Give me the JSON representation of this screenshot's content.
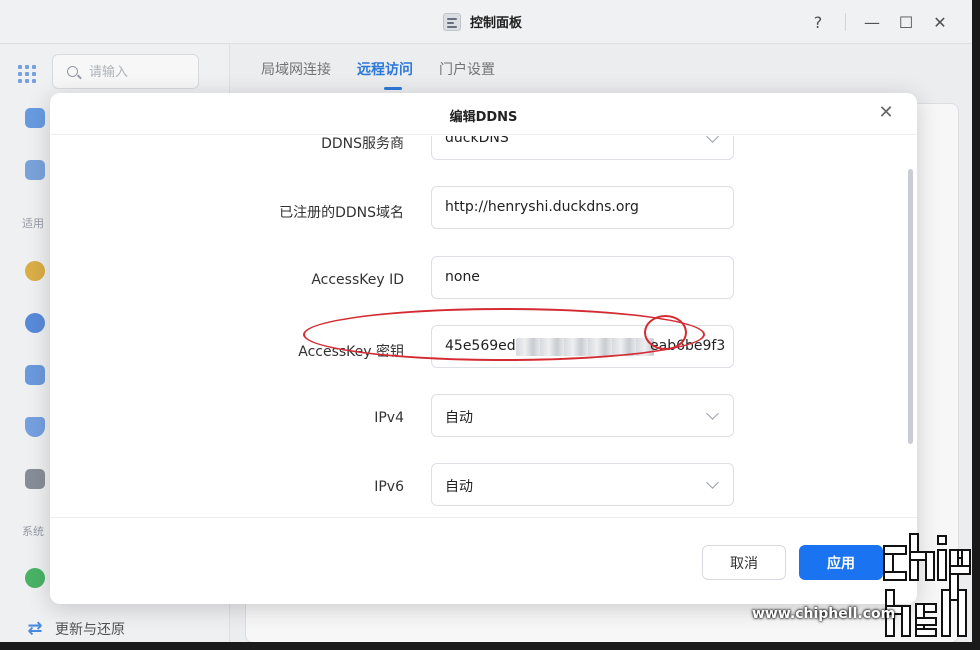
{
  "window": {
    "title": "控制面板",
    "help_label": "?",
    "minimize_label": "—",
    "maximize_label": "☐",
    "close_label": "✕"
  },
  "sidebar": {
    "search_placeholder": "请输入",
    "section_general": "适用",
    "section_system": "系统",
    "bottom_item": "更新与还原",
    "icons": [
      "user-icon",
      "file-icon",
      "storage-icon",
      "network-icon",
      "router-icon",
      "shield-icon",
      "hardware-icon",
      "info-icon",
      "sync-icon"
    ]
  },
  "tabs": [
    {
      "label": "局域网连接",
      "active": false
    },
    {
      "label": "远程访问",
      "active": true
    },
    {
      "label": "门户设置",
      "active": false
    }
  ],
  "modal": {
    "title": "编辑DDNS",
    "close_label": "✕",
    "fields": {
      "provider": {
        "label": "DDNS服务商",
        "value": "duckDNS"
      },
      "domain": {
        "label": "已注册的DDNS域名",
        "value": "http://henryshi.duckdns.org"
      },
      "access_key_id": {
        "label": "AccessKey ID",
        "value": "none"
      },
      "access_key_secret": {
        "label": "AccessKey 密钥",
        "value_prefix": "45e569ed",
        "value_suffix": "eab6be9f3"
      },
      "ipv4": {
        "label": "IPv4",
        "value": "自动"
      },
      "ipv6": {
        "label": "IPv6",
        "value": "自动"
      }
    },
    "cancel_label": "取消",
    "apply_label": "应用"
  },
  "watermark": {
    "text": "www.chiphell.com",
    "logo": "chiphell-logo"
  },
  "colors": {
    "accent": "#1a73f0",
    "tab_active": "#2f7de1",
    "annotation": "#d42a32"
  }
}
